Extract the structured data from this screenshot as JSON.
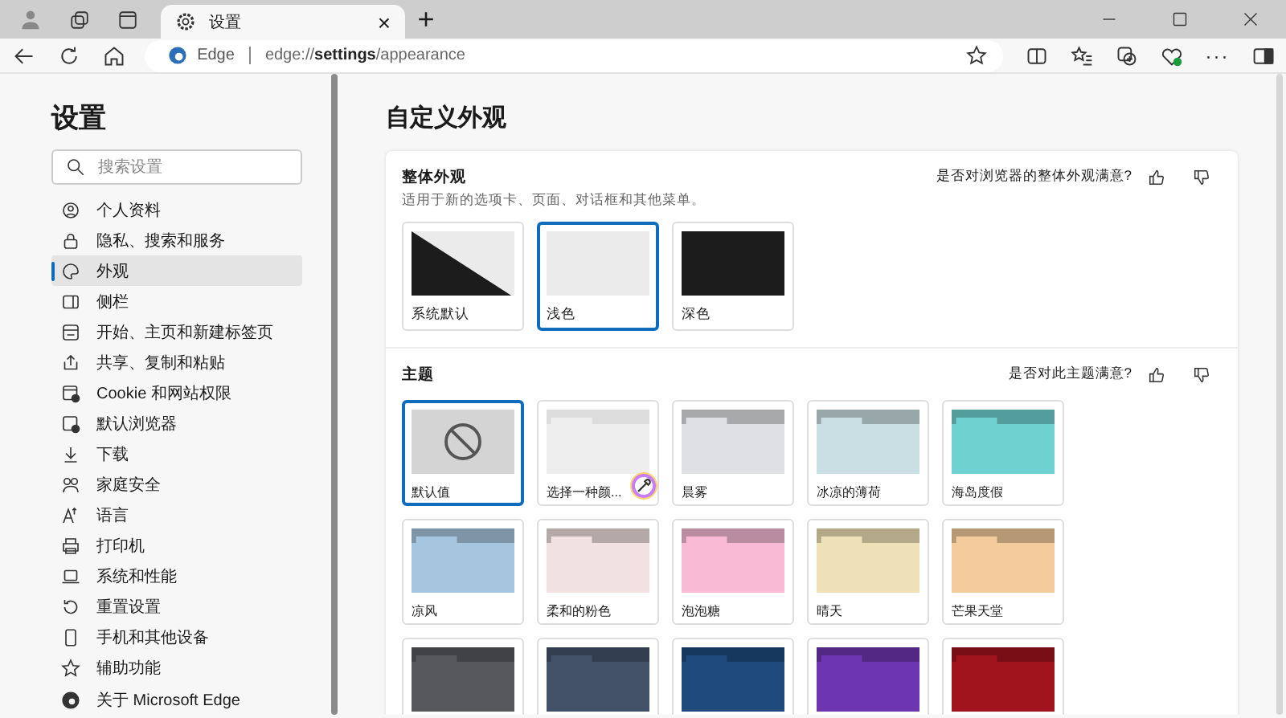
{
  "tabs": [
    {
      "title": "设置",
      "selected": true,
      "close": "×"
    }
  ],
  "new_tab": "+",
  "address_bar": {
    "site": "Edge",
    "url": "edge://**settings**/appearance"
  },
  "toolbar": {
    "more": "···"
  },
  "sidebar": {
    "title": "设置",
    "search": {
      "placeholder": "搜索设置"
    },
    "items": [
      {
        "label": "个人资料",
        "selected": false
      },
      {
        "label": "隐私、搜索和服务",
        "selected": false
      },
      {
        "label": "外观",
        "selected": true
      },
      {
        "label": "侧栏",
        "selected": false
      },
      {
        "label": "开始、主页和新建标签页",
        "selected": false
      },
      {
        "label": "共享、复制和粘贴",
        "selected": false
      },
      {
        "label": "Cookie 和网站权限",
        "selected": false
      },
      {
        "label": "默认浏览器",
        "selected": false
      },
      {
        "label": "下载",
        "selected": false
      },
      {
        "label": "家庭安全",
        "selected": false
      },
      {
        "label": "语言",
        "selected": false
      },
      {
        "label": "打印机",
        "selected": false
      },
      {
        "label": "系统和性能",
        "selected": false
      },
      {
        "label": "重置设置",
        "selected": false
      },
      {
        "label": "手机和其他设备",
        "selected": false
      },
      {
        "label": "辅助功能",
        "selected": false
      },
      {
        "label": "关于 Microsoft Edge",
        "selected": false
      }
    ]
  },
  "page_title": "自定义外观",
  "overall_appearance": {
    "title": "整体外观",
    "description": "适用于新的选项卡、页面、对话框和其他菜单。",
    "feedback": "是否对浏览器的整体外观满意?",
    "options": [
      {
        "label": "系统默认",
        "kind": "system",
        "selected": false
      },
      {
        "label": "浅色",
        "kind": "light",
        "selected": true
      },
      {
        "label": "深色",
        "kind": "dark",
        "selected": false
      }
    ]
  },
  "theme": {
    "title": "主题",
    "feedback": "是否对此主题满意?",
    "options": [
      {
        "label": "默认值",
        "kind": "default",
        "selected": true
      },
      {
        "label": "选择一种颜...",
        "kind": "custom",
        "selected": false,
        "color": "#eeeeee"
      },
      {
        "label": "晨雾",
        "kind": "color",
        "selected": false,
        "color": "#dfe0e3"
      },
      {
        "label": "冰凉的薄荷",
        "kind": "color",
        "selected": false,
        "color": "#cadfe3"
      },
      {
        "label": "海岛度假",
        "kind": "color",
        "selected": false,
        "color": "#6fd1d0"
      },
      {
        "label": "凉风",
        "kind": "color",
        "selected": false,
        "color": "#a6c6df"
      },
      {
        "label": "柔和的粉色",
        "kind": "color",
        "selected": false,
        "color": "#f1e1e0"
      },
      {
        "label": "泡泡糖",
        "kind": "color",
        "selected": false,
        "color": "#f8bad5"
      },
      {
        "label": "晴天",
        "kind": "color",
        "selected": false,
        "color": "#efe1b7"
      },
      {
        "label": "芒果天堂",
        "kind": "color",
        "selected": false,
        "color": "#f4cb9c"
      },
      {
        "kind": "color",
        "selected": false,
        "color": "#57585c"
      },
      {
        "kind": "color",
        "selected": false,
        "color": "#435269"
      },
      {
        "kind": "color",
        "selected": false,
        "color": "#1f4a7d"
      },
      {
        "kind": "color",
        "selected": false,
        "color": "#6e35b0"
      },
      {
        "kind": "color",
        "selected": false,
        "color": "#a1141d"
      }
    ]
  }
}
